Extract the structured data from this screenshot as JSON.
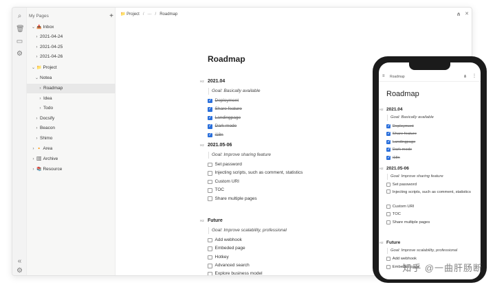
{
  "sidebar": {
    "header": "My Pages",
    "add": "+",
    "items": [
      {
        "chev": "⌄",
        "emoji": "📥",
        "label": "Inbox"
      },
      {
        "chev": "›",
        "emoji": "",
        "label": "2021-04-24"
      },
      {
        "chev": "›",
        "emoji": "",
        "label": "2021-04-25"
      },
      {
        "chev": "›",
        "emoji": "",
        "label": "2021-04-26"
      },
      {
        "chev": "⌄",
        "emoji": "📁",
        "label": "Project"
      },
      {
        "chev": "⌄",
        "emoji": "",
        "label": "Notea"
      },
      {
        "chev": "›",
        "emoji": "",
        "label": "Roadmap"
      },
      {
        "chev": "›",
        "emoji": "",
        "label": "Idea"
      },
      {
        "chev": "›",
        "emoji": "",
        "label": "Todo"
      },
      {
        "chev": "›",
        "emoji": "",
        "label": "Docsify"
      },
      {
        "chev": "›",
        "emoji": "",
        "label": "Beacon"
      },
      {
        "chev": "›",
        "emoji": "",
        "label": "Shimo"
      },
      {
        "chev": "›",
        "emoji": "🔸",
        "label": "Area"
      },
      {
        "chev": "›",
        "emoji": "🗄",
        "label": "Archive"
      },
      {
        "chev": "›",
        "emoji": "📚",
        "label": "Resource"
      }
    ]
  },
  "breadcrumb": {
    "folder_emoji": "📁",
    "folder": "Project",
    "sep1": "/",
    "ellipsis": "···",
    "sep2": "/",
    "page": "Roadmap"
  },
  "doc": {
    "title": "Roadmap",
    "h2_tag": "H2",
    "sections": [
      {
        "heading": "2021.04",
        "goal": "Goal: Basically available",
        "tasks": [
          {
            "t": "Deployment",
            "d": true
          },
          {
            "t": "Share feature",
            "d": true
          },
          {
            "t": "Landingpage",
            "d": true
          },
          {
            "t": "Dark mode",
            "d": true
          },
          {
            "t": "i18n",
            "d": true
          }
        ]
      },
      {
        "heading": "2021.05-06",
        "goal": "Goal: Improve sharing feature",
        "tasks": [
          {
            "t": "Set password",
            "d": false
          },
          {
            "t": "Injecting scripts, such as comment, statistics",
            "d": false
          },
          {
            "t": "Custom URI",
            "d": false
          },
          {
            "t": "TOC",
            "d": false
          },
          {
            "t": "Share multiple pages",
            "d": false
          }
        ]
      },
      {
        "heading": "Future",
        "goal": "Goal: Improve scalability, professional",
        "tasks": [
          {
            "t": "Add webhook",
            "d": false
          },
          {
            "t": "Embeded page",
            "d": false
          },
          {
            "t": "Hotkey",
            "d": false
          },
          {
            "t": "Advanced search",
            "d": false
          },
          {
            "t": "Explore business model",
            "d": false
          }
        ]
      }
    ]
  },
  "mobile": {
    "bar_title": "Roadmap",
    "title": "Roadmap",
    "h2_tag": "H2",
    "sections": [
      {
        "heading": "2021.04",
        "goal": "Goal: Basically available",
        "tasks": [
          {
            "t": "Deployment",
            "d": true
          },
          {
            "t": "Share feature",
            "d": true
          },
          {
            "t": "Landingpage",
            "d": true
          },
          {
            "t": "Dark mode",
            "d": true
          },
          {
            "t": "i18n",
            "d": true
          }
        ]
      },
      {
        "heading": "2021.05-06",
        "goal": "Goal: Improve sharing feature",
        "tasks": [
          {
            "t": "Set password",
            "d": false
          },
          {
            "t": "Injecting scripts, such as comment, statistics",
            "d": false
          },
          {
            "t": "Custom URI",
            "d": false
          },
          {
            "t": "TOC",
            "d": false
          },
          {
            "t": "Share multiple pages",
            "d": false
          }
        ]
      },
      {
        "heading": "Future",
        "goal": "Goal: Improve scalability, professional",
        "tasks": [
          {
            "t": "Add webhook",
            "d": false
          },
          {
            "t": "Embeded page",
            "d": false
          }
        ]
      }
    ]
  },
  "watermark": "知乎 @一曲肝肠断",
  "colors": {
    "check": "#2a6fdb",
    "sidebar_bg": "#f7f7f6"
  }
}
